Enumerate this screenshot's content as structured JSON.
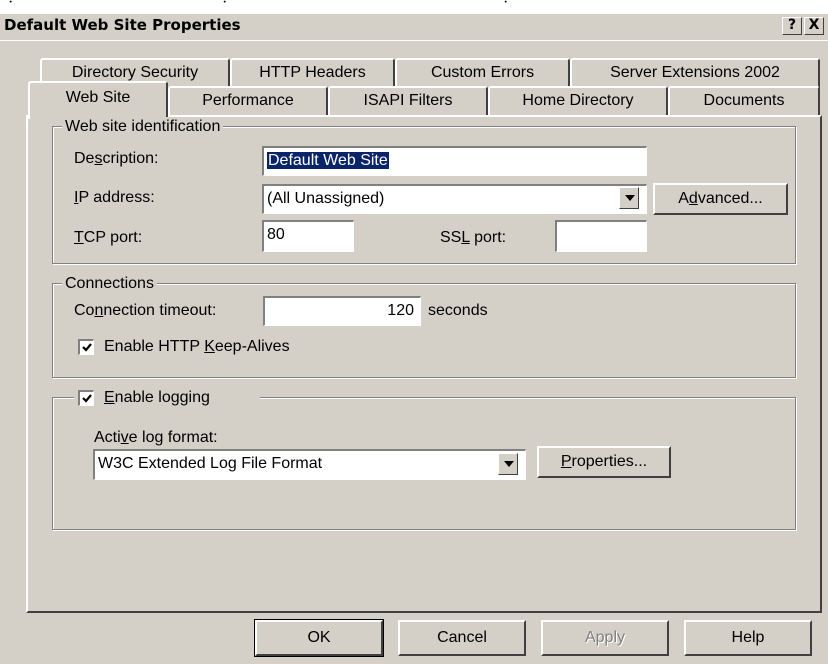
{
  "window": {
    "title": "Default Web Site Properties",
    "help_button": "?",
    "close_button": "X"
  },
  "tabs": {
    "back_row": [
      "Directory Security",
      "HTTP Headers",
      "Custom Errors",
      "Server Extensions 2002"
    ],
    "front_row": [
      "Web Site",
      "Performance",
      "ISAPI Filters",
      "Home Directory",
      "Documents"
    ],
    "active": "Web Site"
  },
  "identification": {
    "legend": "Web site identification",
    "description_label": {
      "pre": "De",
      "key": "s",
      "post": "cription:"
    },
    "description_value": "Default Web Site",
    "ip_label": {
      "pre": "",
      "key": "I",
      "post": "P address:"
    },
    "ip_value": "(All Unassigned)",
    "advanced_button": {
      "pre": "A",
      "key": "d",
      "post": "vanced..."
    },
    "tcp_label": {
      "pre": "",
      "key": "T",
      "post": "CP port:"
    },
    "tcp_value": "80",
    "ssl_label": {
      "pre": "SS",
      "key": "L",
      "post": " port:"
    },
    "ssl_value": ""
  },
  "connections": {
    "legend": "Connections",
    "timeout_label": {
      "pre": "Co",
      "key": "n",
      "post": "nection timeout:"
    },
    "timeout_value": "120",
    "timeout_unit": "seconds",
    "keepalive_label": {
      "pre": "Enable HTTP ",
      "key": "K",
      "post": "eep-Alives"
    },
    "keepalive_checked": true
  },
  "logging": {
    "enable_label": {
      "pre": "",
      "key": "E",
      "post": "nable logging"
    },
    "enable_checked": true,
    "format_label": {
      "pre": "Acti",
      "key": "v",
      "post": "e log format:"
    },
    "format_value": "W3C Extended Log File Format",
    "properties_button": {
      "pre": "",
      "key": "P",
      "post": "roperties..."
    }
  },
  "footer": {
    "ok": "OK",
    "cancel": "Cancel",
    "apply": "Apply",
    "help": "Help"
  },
  "top_strip_text": ". . ."
}
